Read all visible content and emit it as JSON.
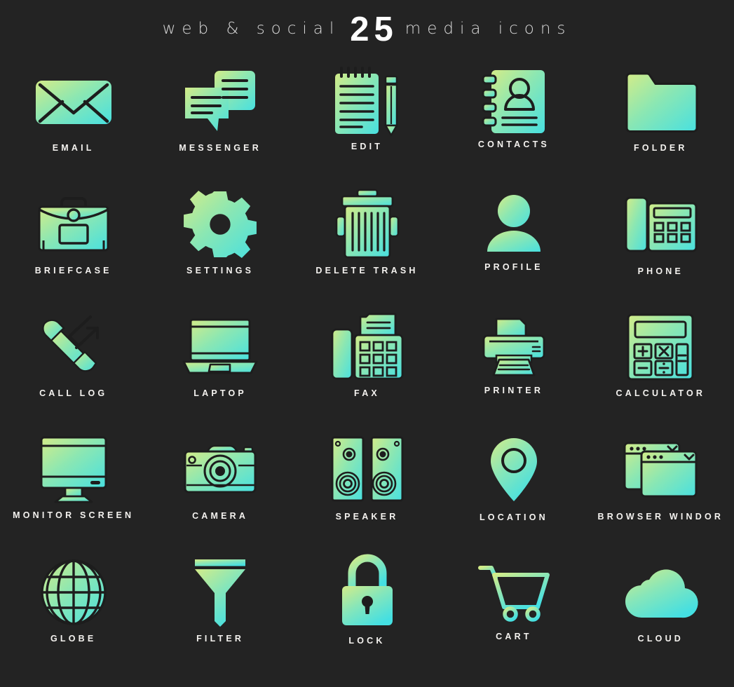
{
  "header": {
    "left_text": "web & social",
    "count": "25",
    "right_text": "media icons"
  },
  "theme": {
    "background": "#232323",
    "label_color": "#f4f2ef",
    "gradient_start": "#cdec8c",
    "gradient_mid": "#8fe8a8",
    "gradient_end": "#4ce0de",
    "stroke_color": "#1d1d1d"
  },
  "grid": {
    "columns": 5,
    "rows": 5,
    "total_icons": "25"
  },
  "icons": [
    {
      "label": "EMAIL",
      "icon": "email-icon"
    },
    {
      "label": "MESSENGER",
      "icon": "messenger-icon"
    },
    {
      "label": "EDIT",
      "icon": "edit-icon"
    },
    {
      "label": "CONTACTS",
      "icon": "contacts-icon"
    },
    {
      "label": "FOLDER",
      "icon": "folder-icon"
    },
    {
      "label": "BRIEFCASE",
      "icon": "briefcase-icon"
    },
    {
      "label": "SETTINGS",
      "icon": "settings-gear-icon"
    },
    {
      "label": "DELETE TRASH",
      "icon": "trash-icon"
    },
    {
      "label": "PROFILE",
      "icon": "profile-icon"
    },
    {
      "label": "PHONE",
      "icon": "desk-phone-icon"
    },
    {
      "label": "CALL LOG",
      "icon": "call-log-icon"
    },
    {
      "label": "LAPTOP",
      "icon": "laptop-icon"
    },
    {
      "label": "FAX",
      "icon": "fax-icon"
    },
    {
      "label": "PRINTER",
      "icon": "printer-icon"
    },
    {
      "label": "CALCULATOR",
      "icon": "calculator-icon"
    },
    {
      "label": "MONITOR SCREEN",
      "icon": "monitor-icon"
    },
    {
      "label": "CAMERA",
      "icon": "camera-icon"
    },
    {
      "label": "SPEAKER",
      "icon": "speaker-icon"
    },
    {
      "label": "LOCATION",
      "icon": "location-pin-icon"
    },
    {
      "label": "BROWSER WINDOR",
      "icon": "browser-window-icon"
    },
    {
      "label": "GLOBE",
      "icon": "globe-icon"
    },
    {
      "label": "FILTER",
      "icon": "filter-funnel-icon"
    },
    {
      "label": "LOCK",
      "icon": "lock-icon"
    },
    {
      "label": "CART",
      "icon": "shopping-cart-icon"
    },
    {
      "label": "CLOUD",
      "icon": "cloud-icon"
    }
  ]
}
